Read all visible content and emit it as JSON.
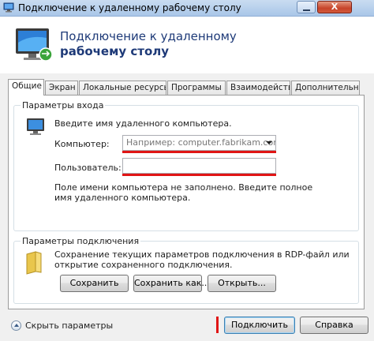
{
  "window": {
    "title": "Подключение к удаленному рабочему столу",
    "close_label": "X"
  },
  "header": {
    "title_line1": "Подключение к удаленному",
    "title_line2": "рабочему столу"
  },
  "tabs": [
    {
      "label": "Общие",
      "active": true
    },
    {
      "label": "Экран",
      "active": false
    },
    {
      "label": "Локальные ресурсы",
      "active": false
    },
    {
      "label": "Программы",
      "active": false
    },
    {
      "label": "Взаимодействие",
      "active": false
    },
    {
      "label": "Дополнительно",
      "active": false
    }
  ],
  "login_group": {
    "legend": "Параметры входа",
    "hint": "Введите имя удаленного компьютера.",
    "computer_label": "Компьютер:",
    "computer_placeholder": "Например: computer.fabrikam.com",
    "user_label": "Пользователь:",
    "user_value": "",
    "warning_line1": "Поле имени компьютера не заполнено. Введите полное",
    "warning_line2": "имя удаленного компьютера."
  },
  "connection_group": {
    "legend": "Параметры подключения",
    "desc_line1": "Сохранение текущих параметров подключения в RDP-файл или",
    "desc_line2": "открытие сохраненного подключения.",
    "save_label": "Сохранить",
    "save_as_label": "Сохранить как...",
    "open_label": "Открыть..."
  },
  "footer": {
    "hide_options_label": "Скрыть параметры",
    "connect_label": "Подключить",
    "help_label": "Справка"
  },
  "colors": {
    "highlight": "#e01515",
    "header_title": "#1e3a78"
  }
}
